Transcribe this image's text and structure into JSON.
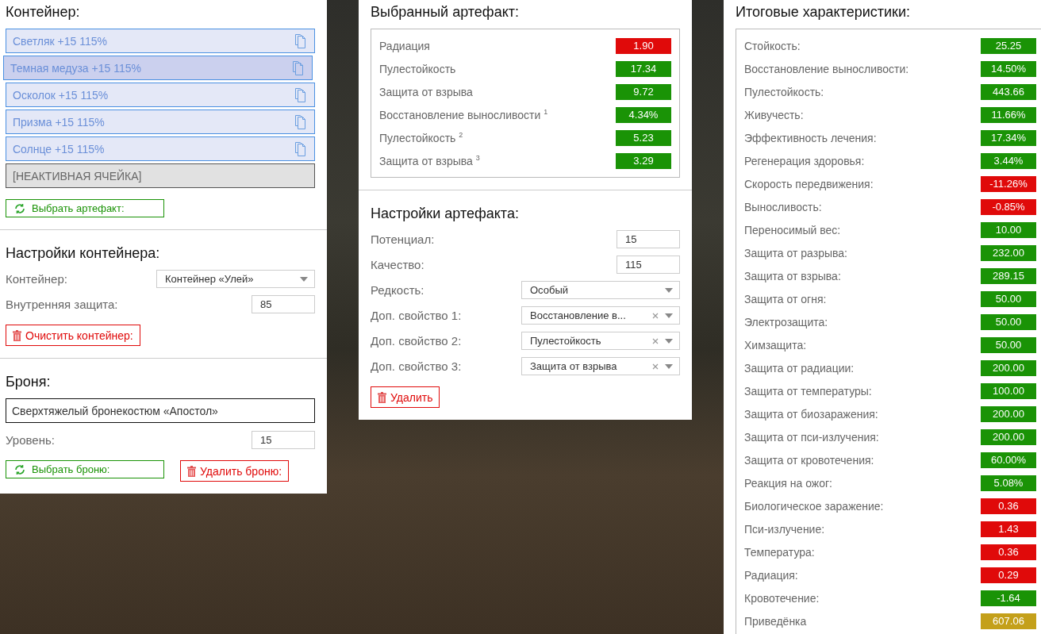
{
  "container_panel": {
    "title": "Контейнер:",
    "slots": [
      {
        "kind": "artifact",
        "label": "Светляк +15 115%",
        "selected": false
      },
      {
        "kind": "artifact",
        "label": "Темная медуза +15 115%",
        "selected": true
      },
      {
        "kind": "artifact",
        "label": "Осколок +15 115%",
        "selected": false
      },
      {
        "kind": "artifact",
        "label": "Призма +15 115%",
        "selected": false
      },
      {
        "kind": "artifact",
        "label": "Солнце +15 115%",
        "selected": false
      },
      {
        "kind": "inactive",
        "label": "[НЕАКТИВНАЯ ЯЧЕЙКА]",
        "selected": false
      }
    ],
    "buttons": [
      {
        "kind": "select",
        "label": "Выбрать артефакт:"
      }
    ]
  },
  "container_settings": {
    "title": "Настройки контейнера:",
    "fields": [
      {
        "kind": "select",
        "label": "Контейнер:",
        "value": "Контейнер «Улей»",
        "clearable": false
      },
      {
        "kind": "input",
        "label": "Внутренняя защита:",
        "value": "85"
      }
    ],
    "buttons": [
      {
        "kind": "delete",
        "label": "Очистить контейнер:"
      }
    ]
  },
  "armor": {
    "title": "Броня:",
    "name": "Сверхтяжелый бронекостюм «Апостол»",
    "fields": [
      {
        "kind": "input",
        "label": "Уровень:",
        "value": "15"
      }
    ],
    "buttons": [
      {
        "kind": "select",
        "label": "Выбрать броню:"
      },
      {
        "kind": "delete",
        "label": "Удалить броню:"
      }
    ]
  },
  "selected_artifact": {
    "title": "Выбранный артефакт:",
    "stats": [
      {
        "label": "Радиация",
        "value": "1.90",
        "color": "#e00a0a"
      },
      {
        "label": "Пулестойкость",
        "value": "17.34",
        "color": "#1a9306"
      },
      {
        "label": "Защита от взрыва",
        "value": "9.72",
        "color": "#1a9306"
      },
      {
        "label": "Восстановление выносливости $^{1}$",
        "value": "4.34%",
        "color": "#1a9306"
      },
      {
        "label": "Пулестойкость $^{2}$",
        "value": "5.23",
        "color": "#1a9306"
      },
      {
        "label": "Защита от взрыва $^{3}$",
        "value": "3.29",
        "color": "#1a9306"
      }
    ]
  },
  "artifact_settings": {
    "title": "Настройки артефакта:",
    "fields": [
      {
        "kind": "input",
        "label": "Потенциал:",
        "value": "15"
      },
      {
        "kind": "input",
        "label": "Качество:",
        "value": "115"
      },
      {
        "kind": "select",
        "label": "Редкость:",
        "value": "Особый",
        "clearable": false
      },
      {
        "kind": "select",
        "label": "Доп. свойство 1:",
        "value": "Восстановление в...",
        "clearable": true
      },
      {
        "kind": "select",
        "label": "Доп. свойство 2:",
        "value": "Пулестойкость",
        "clearable": true
      },
      {
        "kind": "select",
        "label": "Доп. свойство 3:",
        "value": "Защита от взрыва",
        "clearable": true
      }
    ],
    "buttons": [
      {
        "kind": "delete",
        "label": "Удалить"
      }
    ]
  },
  "totals": {
    "title": "Итоговые характеристики:",
    "stats": [
      {
        "label": "Стойкость:",
        "value": "25.25",
        "color": "#1a9306"
      },
      {
        "label": "Восстановление выносливости:",
        "value": "14.50%",
        "color": "#1a9306"
      },
      {
        "label": "Пулестойкость:",
        "value": "443.66",
        "color": "#1a9306"
      },
      {
        "label": "Живучесть:",
        "value": "11.66%",
        "color": "#1a9306"
      },
      {
        "label": "Эффективность лечения:",
        "value": "17.34%",
        "color": "#1a9306"
      },
      {
        "label": "Регенерация здоровья:",
        "value": "3.44%",
        "color": "#1a9306"
      },
      {
        "label": "Скорость передвижения:",
        "value": "-11.26%",
        "color": "#e00a0a"
      },
      {
        "label": "Выносливость:",
        "value": "-0.85%",
        "color": "#e00a0a"
      },
      {
        "label": "Переносимый вес:",
        "value": "10.00",
        "color": "#1a9306"
      },
      {
        "label": "Защита от разрыва:",
        "value": "232.00",
        "color": "#1a9306"
      },
      {
        "label": "Защита от взрыва:",
        "value": "289.15",
        "color": "#1a9306"
      },
      {
        "label": "Защита от огня:",
        "value": "50.00",
        "color": "#1a9306"
      },
      {
        "label": "Электрозащита:",
        "value": "50.00",
        "color": "#1a9306"
      },
      {
        "label": "Химзащита:",
        "value": "50.00",
        "color": "#1a9306"
      },
      {
        "label": "Защита от радиации:",
        "value": "200.00",
        "color": "#1a9306"
      },
      {
        "label": "Защита от температуры:",
        "value": "100.00",
        "color": "#1a9306"
      },
      {
        "label": "Защита от биозаражения:",
        "value": "200.00",
        "color": "#1a9306"
      },
      {
        "label": "Защита от пси-излучения:",
        "value": "200.00",
        "color": "#1a9306"
      },
      {
        "label": "Защита от кровотечения:",
        "value": "60.00%",
        "color": "#1a9306"
      },
      {
        "label": "Реакция на ожог:",
        "value": "5.08%",
        "color": "#1a9306"
      },
      {
        "label": "Биологическое заражение:",
        "value": "0.36",
        "color": "#e00a0a"
      },
      {
        "label": "Пси-излучение:",
        "value": "1.43",
        "color": "#e00a0a"
      },
      {
        "label": "Температура:",
        "value": "0.36",
        "color": "#e00a0a"
      },
      {
        "label": "Радиация:",
        "value": "0.29",
        "color": "#e00a0a"
      },
      {
        "label": "Кровотечение:",
        "value": "-1.64",
        "color": "#1a9306"
      },
      {
        "label": "Приведёнка",
        "value": "607.06",
        "color": "#c4a01a"
      }
    ]
  }
}
